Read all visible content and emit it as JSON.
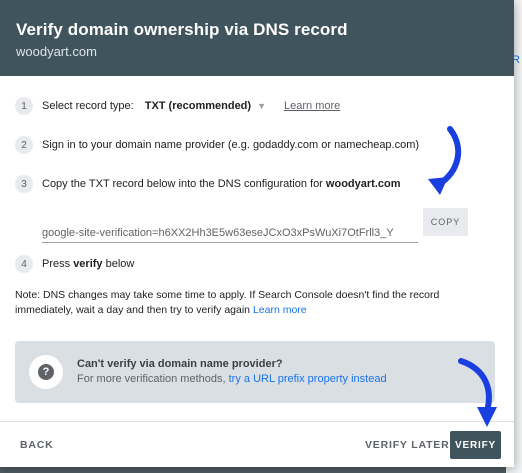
{
  "background": {
    "edge_letter": "R"
  },
  "dialog": {
    "title": "Verify domain ownership via DNS record",
    "domain": "woodyart.com"
  },
  "steps": [
    {
      "number": "1",
      "label": "Select record type:",
      "select_value": "TXT (recommended)",
      "learn_more": "Learn more"
    },
    {
      "number": "2",
      "text": "Sign in to your domain name provider (e.g. godaddy.com or namecheap.com)"
    },
    {
      "number": "3",
      "text": "Copy the TXT record below into the DNS configuration for",
      "domain": "woodyart.com"
    },
    {
      "number": "4",
      "text_before": "Press",
      "bold": "verify",
      "text_after": "below"
    }
  ],
  "txt_record": {
    "value": "google-site-verification=h6XX2Hh3E5w63eseJCxO3xPsWuXi7OtFrll3_Y",
    "copy_label": "COPY"
  },
  "note": {
    "text": "Note: DNS changes may take some time to apply. If Search Console doesn't find the record immediately, wait a day and then try to verify again",
    "link": "Learn more"
  },
  "help_card": {
    "icon": "help-icon",
    "title": "Can't verify via domain name provider?",
    "desc": "For more verification methods,",
    "link": "try a URL prefix property instead"
  },
  "footer": {
    "back": "BACK",
    "verify_later": "VERIFY LATER",
    "verify": "VERIFY"
  },
  "colors": {
    "header_bg": "#3f545c",
    "link": "#1a73e8",
    "annotation_arrow": "#1a3fe0"
  }
}
